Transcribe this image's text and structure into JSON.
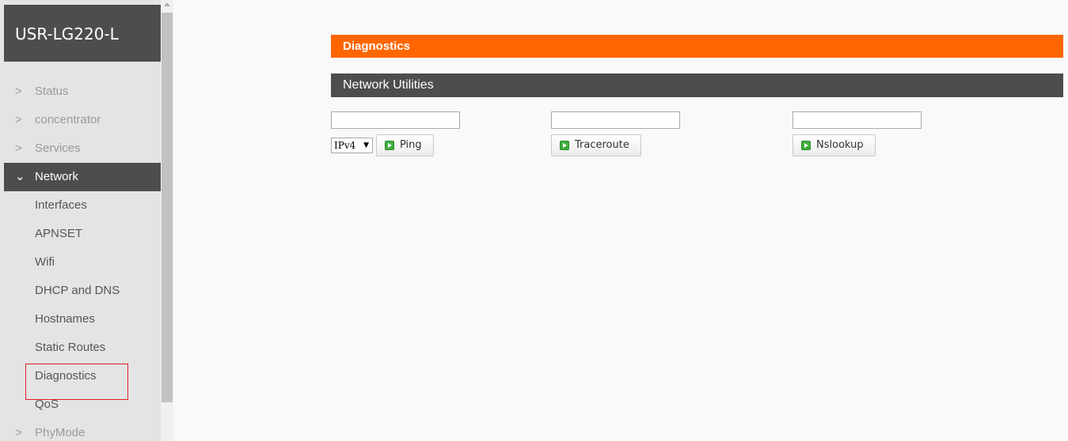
{
  "brand": "USR-LG220-L",
  "nav": {
    "items_before": [
      {
        "label": "Status"
      },
      {
        "label": "concentrator"
      },
      {
        "label": "Services"
      }
    ],
    "active": {
      "label": "Network"
    },
    "subitems": [
      {
        "label": "Interfaces"
      },
      {
        "label": "APNSET"
      },
      {
        "label": "Wifi"
      },
      {
        "label": "DHCP and DNS"
      },
      {
        "label": "Hostnames"
      },
      {
        "label": "Static Routes"
      },
      {
        "label": "Diagnostics"
      },
      {
        "label": "QoS"
      }
    ],
    "items_after": [
      {
        "label": "PhyMode"
      }
    ]
  },
  "page": {
    "title": "Diagnostics",
    "section": "Network Utilities"
  },
  "tools": {
    "ping": {
      "input_value": "",
      "protocol": "IPv4",
      "button": "Ping"
    },
    "traceroute": {
      "input_value": "",
      "button": "Traceroute"
    },
    "nslookup": {
      "input_value": "",
      "button": "Nslookup"
    }
  },
  "colors": {
    "accent": "#ff6600",
    "dark": "#4d4d4d",
    "highlight_box": "#e02020"
  }
}
